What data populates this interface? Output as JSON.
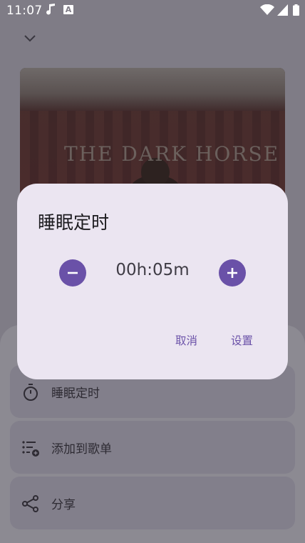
{
  "status_bar": {
    "time": "11:07",
    "icons": [
      "music-note-icon",
      "a-icon",
      "wifi-icon",
      "signal-icon",
      "battery-icon"
    ],
    "a_glyph": "A"
  },
  "player": {
    "collapse_icon": "chevron-down-icon",
    "cover": {
      "title_text": "THE DARK HORSE"
    }
  },
  "bottom_sheet": {
    "items": [
      {
        "label": "睡眠定时",
        "icon": "timer-icon"
      },
      {
        "label": "添加到歌单",
        "icon": "playlist-add-icon"
      },
      {
        "label": "分享",
        "icon": "share-icon"
      }
    ]
  },
  "dialog": {
    "title": "睡眠定时",
    "time_value": "00h:05m",
    "decrease_icon": "minus-icon",
    "increase_icon": "plus-icon",
    "cancel_label": "取消",
    "confirm_label": "设置"
  },
  "colors": {
    "accent": "#6a51a8",
    "dialog_bg": "#ebe5f1",
    "scrim_bg": "#7f7c86"
  }
}
